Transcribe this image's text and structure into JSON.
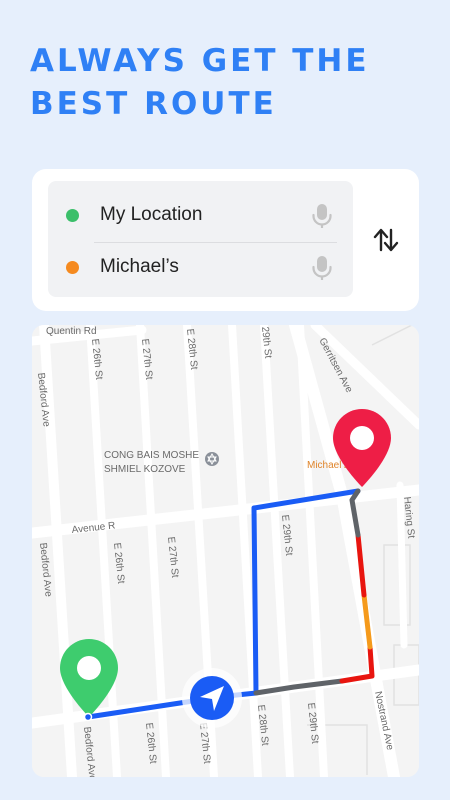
{
  "headline": {
    "line1": "ALWAYS GET THE",
    "line2": "BEST ROUTE"
  },
  "route": {
    "origin_label": "My Location",
    "destination_label": "Michael’s",
    "origin_dot_color": "#3bbf6a",
    "destination_dot_color": "#f58a1f",
    "mic_icon": "mic-icon",
    "swap_icon": "swap-vertical-icon"
  },
  "map": {
    "streets": {
      "quentin": "Quentin Rd",
      "bedford_top": "Bedford Ave",
      "e26_top": "E 26th St",
      "e27_top": "E 27th St",
      "e28_top": "E 28th St",
      "e29_top": "29th St",
      "gerritsen": "Gerritsen Ave",
      "avenue_r": "Avenue R",
      "bedford_mid": "Bedford Ave",
      "e26_mid": "E 26th St",
      "e27_mid": "E 27th St",
      "e29_mid": "E 29th St",
      "haring": "Haring St",
      "bedford_bot": "Bedford Ave",
      "e26_bot": "E 26th St",
      "e27_bot": "E 27th St",
      "e28_bot": "E 28th St",
      "e29_bot": "E 29th St",
      "nostrand": "Nostrand Ave"
    },
    "poi_line1": "CONG BAIS MOSHE",
    "poi_line2": "SHMIEL KOZOVE",
    "dest_poi": "Michael’s",
    "route_color": "#1a5cf5",
    "traffic_colors": {
      "slow": "#5f6368",
      "heavy": "#e8150f",
      "moderate": "#f59a1b"
    },
    "start_pin_color": "#3ecc6e",
    "end_pin_color": "#ee1e46",
    "nav_icon": "navigation-arrow-icon"
  }
}
